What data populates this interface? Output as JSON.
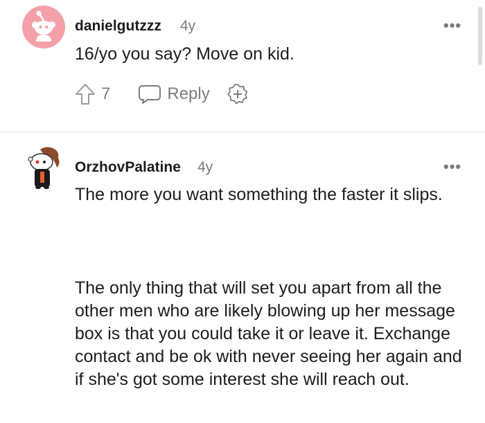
{
  "comments": [
    {
      "username": "danielgutzzz",
      "age": "4y",
      "body": "16/yo you say? Move on kid.",
      "votes": "7",
      "reply_label": "Reply",
      "more_label": "•••",
      "colors": {
        "avatar_bg": "#f3a0a8",
        "avatar_fg": "#ffffff"
      }
    },
    {
      "username": "OrzhovPalatine",
      "age": "4y",
      "paragraphs": [
        "The more you want something the faster it slips.",
        "The only thing that will set you apart from all the other men who are likely blowing up her message box is that you could take it or leave it. Exchange contact and be ok with never seeing her again and if she's got some interest she will reach out."
      ],
      "more_label": "•••"
    }
  ]
}
